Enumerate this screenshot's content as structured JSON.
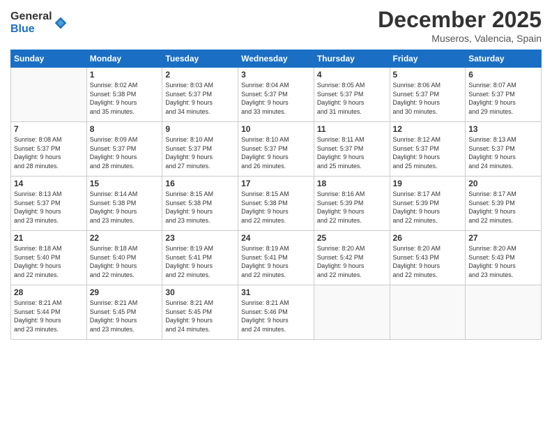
{
  "header": {
    "logo": {
      "general": "General",
      "blue": "Blue"
    },
    "title": "December 2025",
    "location": "Museros, Valencia, Spain"
  },
  "days_of_week": [
    "Sunday",
    "Monday",
    "Tuesday",
    "Wednesday",
    "Thursday",
    "Friday",
    "Saturday"
  ],
  "weeks": [
    [
      {
        "day": "",
        "info": ""
      },
      {
        "day": "1",
        "info": "Sunrise: 8:02 AM\nSunset: 5:38 PM\nDaylight: 9 hours\nand 35 minutes."
      },
      {
        "day": "2",
        "info": "Sunrise: 8:03 AM\nSunset: 5:37 PM\nDaylight: 9 hours\nand 34 minutes."
      },
      {
        "day": "3",
        "info": "Sunrise: 8:04 AM\nSunset: 5:37 PM\nDaylight: 9 hours\nand 33 minutes."
      },
      {
        "day": "4",
        "info": "Sunrise: 8:05 AM\nSunset: 5:37 PM\nDaylight: 9 hours\nand 31 minutes."
      },
      {
        "day": "5",
        "info": "Sunrise: 8:06 AM\nSunset: 5:37 PM\nDaylight: 9 hours\nand 30 minutes."
      },
      {
        "day": "6",
        "info": "Sunrise: 8:07 AM\nSunset: 5:37 PM\nDaylight: 9 hours\nand 29 minutes."
      }
    ],
    [
      {
        "day": "7",
        "info": "Sunrise: 8:08 AM\nSunset: 5:37 PM\nDaylight: 9 hours\nand 28 minutes."
      },
      {
        "day": "8",
        "info": "Sunrise: 8:09 AM\nSunset: 5:37 PM\nDaylight: 9 hours\nand 28 minutes."
      },
      {
        "day": "9",
        "info": "Sunrise: 8:10 AM\nSunset: 5:37 PM\nDaylight: 9 hours\nand 27 minutes."
      },
      {
        "day": "10",
        "info": "Sunrise: 8:10 AM\nSunset: 5:37 PM\nDaylight: 9 hours\nand 26 minutes."
      },
      {
        "day": "11",
        "info": "Sunrise: 8:11 AM\nSunset: 5:37 PM\nDaylight: 9 hours\nand 25 minutes."
      },
      {
        "day": "12",
        "info": "Sunrise: 8:12 AM\nSunset: 5:37 PM\nDaylight: 9 hours\nand 25 minutes."
      },
      {
        "day": "13",
        "info": "Sunrise: 8:13 AM\nSunset: 5:37 PM\nDaylight: 9 hours\nand 24 minutes."
      }
    ],
    [
      {
        "day": "14",
        "info": "Sunrise: 8:13 AM\nSunset: 5:37 PM\nDaylight: 9 hours\nand 23 minutes."
      },
      {
        "day": "15",
        "info": "Sunrise: 8:14 AM\nSunset: 5:38 PM\nDaylight: 9 hours\nand 23 minutes."
      },
      {
        "day": "16",
        "info": "Sunrise: 8:15 AM\nSunset: 5:38 PM\nDaylight: 9 hours\nand 23 minutes."
      },
      {
        "day": "17",
        "info": "Sunrise: 8:15 AM\nSunset: 5:38 PM\nDaylight: 9 hours\nand 22 minutes."
      },
      {
        "day": "18",
        "info": "Sunrise: 8:16 AM\nSunset: 5:39 PM\nDaylight: 9 hours\nand 22 minutes."
      },
      {
        "day": "19",
        "info": "Sunrise: 8:17 AM\nSunset: 5:39 PM\nDaylight: 9 hours\nand 22 minutes."
      },
      {
        "day": "20",
        "info": "Sunrise: 8:17 AM\nSunset: 5:39 PM\nDaylight: 9 hours\nand 22 minutes."
      }
    ],
    [
      {
        "day": "21",
        "info": "Sunrise: 8:18 AM\nSunset: 5:40 PM\nDaylight: 9 hours\nand 22 minutes."
      },
      {
        "day": "22",
        "info": "Sunrise: 8:18 AM\nSunset: 5:40 PM\nDaylight: 9 hours\nand 22 minutes."
      },
      {
        "day": "23",
        "info": "Sunrise: 8:19 AM\nSunset: 5:41 PM\nDaylight: 9 hours\nand 22 minutes."
      },
      {
        "day": "24",
        "info": "Sunrise: 8:19 AM\nSunset: 5:41 PM\nDaylight: 9 hours\nand 22 minutes."
      },
      {
        "day": "25",
        "info": "Sunrise: 8:20 AM\nSunset: 5:42 PM\nDaylight: 9 hours\nand 22 minutes."
      },
      {
        "day": "26",
        "info": "Sunrise: 8:20 AM\nSunset: 5:43 PM\nDaylight: 9 hours\nand 22 minutes."
      },
      {
        "day": "27",
        "info": "Sunrise: 8:20 AM\nSunset: 5:43 PM\nDaylight: 9 hours\nand 23 minutes."
      }
    ],
    [
      {
        "day": "28",
        "info": "Sunrise: 8:21 AM\nSunset: 5:44 PM\nDaylight: 9 hours\nand 23 minutes."
      },
      {
        "day": "29",
        "info": "Sunrise: 8:21 AM\nSunset: 5:45 PM\nDaylight: 9 hours\nand 23 minutes."
      },
      {
        "day": "30",
        "info": "Sunrise: 8:21 AM\nSunset: 5:45 PM\nDaylight: 9 hours\nand 24 minutes."
      },
      {
        "day": "31",
        "info": "Sunrise: 8:21 AM\nSunset: 5:46 PM\nDaylight: 9 hours\nand 24 minutes."
      },
      {
        "day": "",
        "info": ""
      },
      {
        "day": "",
        "info": ""
      },
      {
        "day": "",
        "info": ""
      }
    ]
  ]
}
